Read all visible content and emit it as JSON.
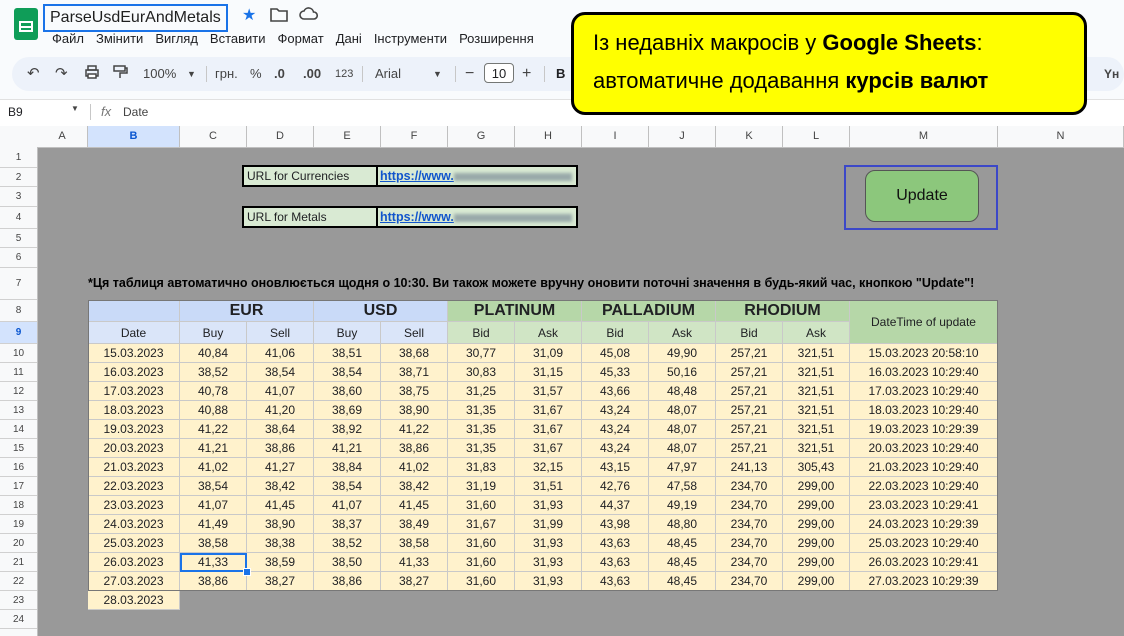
{
  "window": {
    "doc_title": "ParseUsdEurAndMetals",
    "menu": [
      "Файл",
      "Змінити",
      "Вигляд",
      "Вставити",
      "Формат",
      "Дані",
      "Інструменти",
      "Розширення"
    ]
  },
  "toolbar": {
    "zoom": "100%",
    "currency": "грн.",
    "percent": "%",
    "dec_decrease": ".0",
    "dec_increase": ".00",
    "number_format": "123",
    "font": "Arial",
    "font_size": "10",
    "bold": "B",
    "side_icon": "Yн"
  },
  "formula_bar": {
    "cell_ref": "B9",
    "fx": "fx",
    "content": "Date"
  },
  "columns": [
    "A",
    "B",
    "C",
    "D",
    "E",
    "F",
    "G",
    "H",
    "I",
    "J",
    "K",
    "L",
    "M",
    "N"
  ],
  "selected_column": "B",
  "selected_row": 9,
  "sheet": {
    "url_currencies_label": "URL for Currencies",
    "url_currencies_value": "https://www.",
    "url_metals_label": "URL for Metals",
    "url_metals_value": "https://www.",
    "update_button": "Update",
    "note": "*Ця таблиця автоматично оновлюється щодня о 10:30. Ви також можете вручну оновити поточні значення в будь-який час, кнопкою \"Update\"!",
    "header_groups": [
      "EUR",
      "USD",
      "PLATINUM",
      "PALLADIUM",
      "RHODIUM"
    ],
    "header_datetime": "DateTime of update",
    "subheaders": [
      "Date",
      "Buy",
      "Sell",
      "Buy",
      "Sell",
      "Bid",
      "Ask",
      "Bid",
      "Ask",
      "Bid",
      "Ask"
    ],
    "rows": [
      [
        "15.03.2023",
        "40,84",
        "41,06",
        "38,51",
        "38,68",
        "30,77",
        "31,09",
        "45,08",
        "49,90",
        "257,21",
        "321,51",
        "15.03.2023 20:58:10"
      ],
      [
        "16.03.2023",
        "38,52",
        "38,54",
        "38,54",
        "38,71",
        "30,83",
        "31,15",
        "45,33",
        "50,16",
        "257,21",
        "321,51",
        "16.03.2023 10:29:40"
      ],
      [
        "17.03.2023",
        "40,78",
        "41,07",
        "38,60",
        "38,75",
        "31,25",
        "31,57",
        "43,66",
        "48,48",
        "257,21",
        "321,51",
        "17.03.2023 10:29:40"
      ],
      [
        "18.03.2023",
        "40,88",
        "41,20",
        "38,69",
        "38,90",
        "31,35",
        "31,67",
        "43,24",
        "48,07",
        "257,21",
        "321,51",
        "18.03.2023 10:29:40"
      ],
      [
        "19.03.2023",
        "41,22",
        "38,64",
        "38,92",
        "41,22",
        "31,35",
        "31,67",
        "43,24",
        "48,07",
        "257,21",
        "321,51",
        "19.03.2023 10:29:39"
      ],
      [
        "20.03.2023",
        "41,21",
        "38,86",
        "41,21",
        "38,86",
        "31,35",
        "31,67",
        "43,24",
        "48,07",
        "257,21",
        "321,51",
        "20.03.2023 10:29:40"
      ],
      [
        "21.03.2023",
        "41,02",
        "41,27",
        "38,84",
        "41,02",
        "31,83",
        "32,15",
        "43,15",
        "47,97",
        "241,13",
        "305,43",
        "21.03.2023 10:29:40"
      ],
      [
        "22.03.2023",
        "38,54",
        "38,42",
        "38,54",
        "38,42",
        "31,19",
        "31,51",
        "42,76",
        "47,58",
        "234,70",
        "299,00",
        "22.03.2023 10:29:40"
      ],
      [
        "23.03.2023",
        "41,07",
        "41,45",
        "41,07",
        "41,45",
        "31,60",
        "31,93",
        "44,37",
        "49,19",
        "234,70",
        "299,00",
        "23.03.2023 10:29:41"
      ],
      [
        "24.03.2023",
        "41,49",
        "38,90",
        "38,37",
        "38,49",
        "31,67",
        "31,99",
        "43,98",
        "48,80",
        "234,70",
        "299,00",
        "24.03.2023 10:29:39"
      ],
      [
        "25.03.2023",
        "38,58",
        "38,38",
        "38,52",
        "38,58",
        "31,60",
        "31,93",
        "43,63",
        "48,45",
        "234,70",
        "299,00",
        "25.03.2023 10:29:40"
      ],
      [
        "26.03.2023",
        "41,33",
        "38,59",
        "38,50",
        "41,33",
        "31,60",
        "31,93",
        "43,63",
        "48,45",
        "234,70",
        "299,00",
        "26.03.2023 10:29:41"
      ],
      [
        "27.03.2023",
        "38,86",
        "38,27",
        "38,86",
        "38,27",
        "31,60",
        "31,93",
        "43,63",
        "48,45",
        "234,70",
        "299,00",
        "27.03.2023 10:29:39"
      ]
    ],
    "next_date": "28.03.2023"
  },
  "callout": {
    "line1_prefix": "Із недавніх макросів у ",
    "line1_bold": "Google Sheets",
    "line1_suffix": ":",
    "line2_prefix": "автоматичне додавання ",
    "line2_bold": "курсів валют"
  },
  "colors": {
    "accent": "#1a73e8",
    "header_currency": "#c9daf8",
    "header_metal": "#b6d7a8",
    "data_row": "#fff2cc",
    "callout": "#ffff00",
    "update_button": "#8cc77c"
  }
}
